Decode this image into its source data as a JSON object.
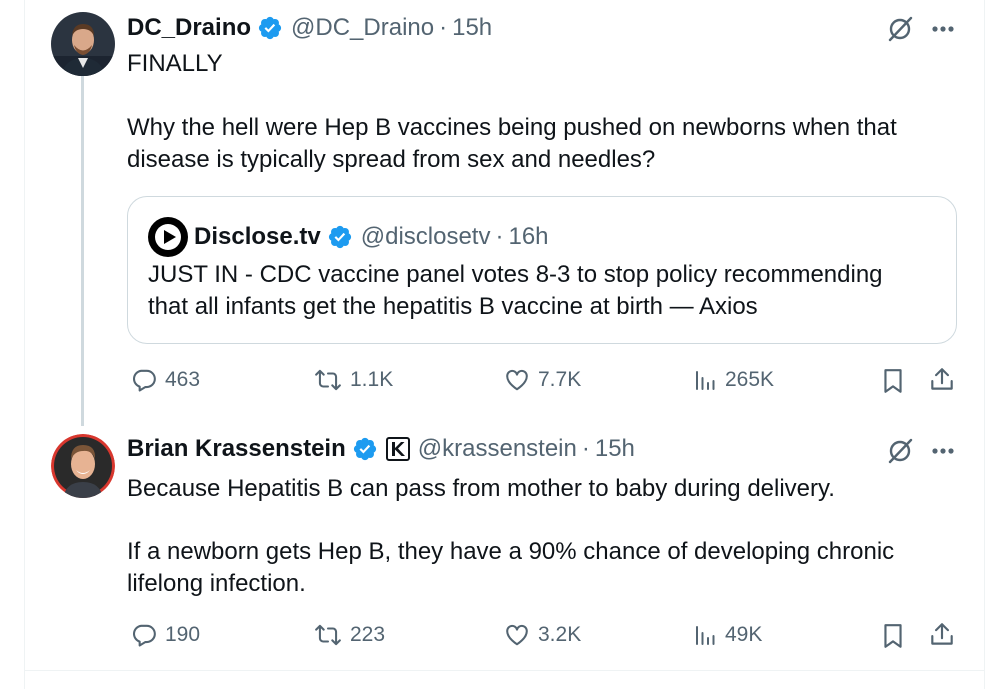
{
  "tweet1": {
    "display_name": "DC_Draino",
    "handle": "@DC_Draino",
    "separator": "·",
    "time": "15h",
    "line1": "FINALLY",
    "line2": "Why the hell were Hep B vaccines being pushed on newborns when that",
    "line3": "disease is typically spread from sex and needles?",
    "quote": {
      "display_name": "Disclose.tv",
      "handle": "@disclosetv",
      "separator": "·",
      "time": "16h",
      "line1": "JUST IN - CDC vaccine panel votes 8-3 to stop policy recommending",
      "line2": "that all infants get the hepatitis B vaccine at birth — Axios"
    },
    "actions": {
      "replies": "463",
      "reposts": "1.1K",
      "likes": "7.7K",
      "views": "265K"
    }
  },
  "tweet2": {
    "display_name": "Brian Krassenstein",
    "handle": "@krassenstein",
    "separator": "·",
    "time": "15h",
    "line1": "Because Hepatitis B can pass from mother to baby during delivery.",
    "line2": "If a newborn gets Hep B, they have a 90% chance of developing chronic",
    "line3": "lifelong infection.",
    "actions": {
      "replies": "190",
      "reposts": "223",
      "likes": "3.2K",
      "views": "49K"
    }
  },
  "colors": {
    "verified": "#1d9bf0",
    "text_primary": "#0f1419",
    "text_secondary": "#536471",
    "border": "#cfd9de",
    "thread_line": "#cfd9de"
  },
  "icons": [
    "verified-badge-icon",
    "grok-icon",
    "more-icon",
    "reply-icon",
    "repost-icon",
    "like-icon",
    "views-icon",
    "bookmark-icon",
    "share-icon",
    "affiliate-badge-icon",
    "disclose-play-icon"
  ]
}
